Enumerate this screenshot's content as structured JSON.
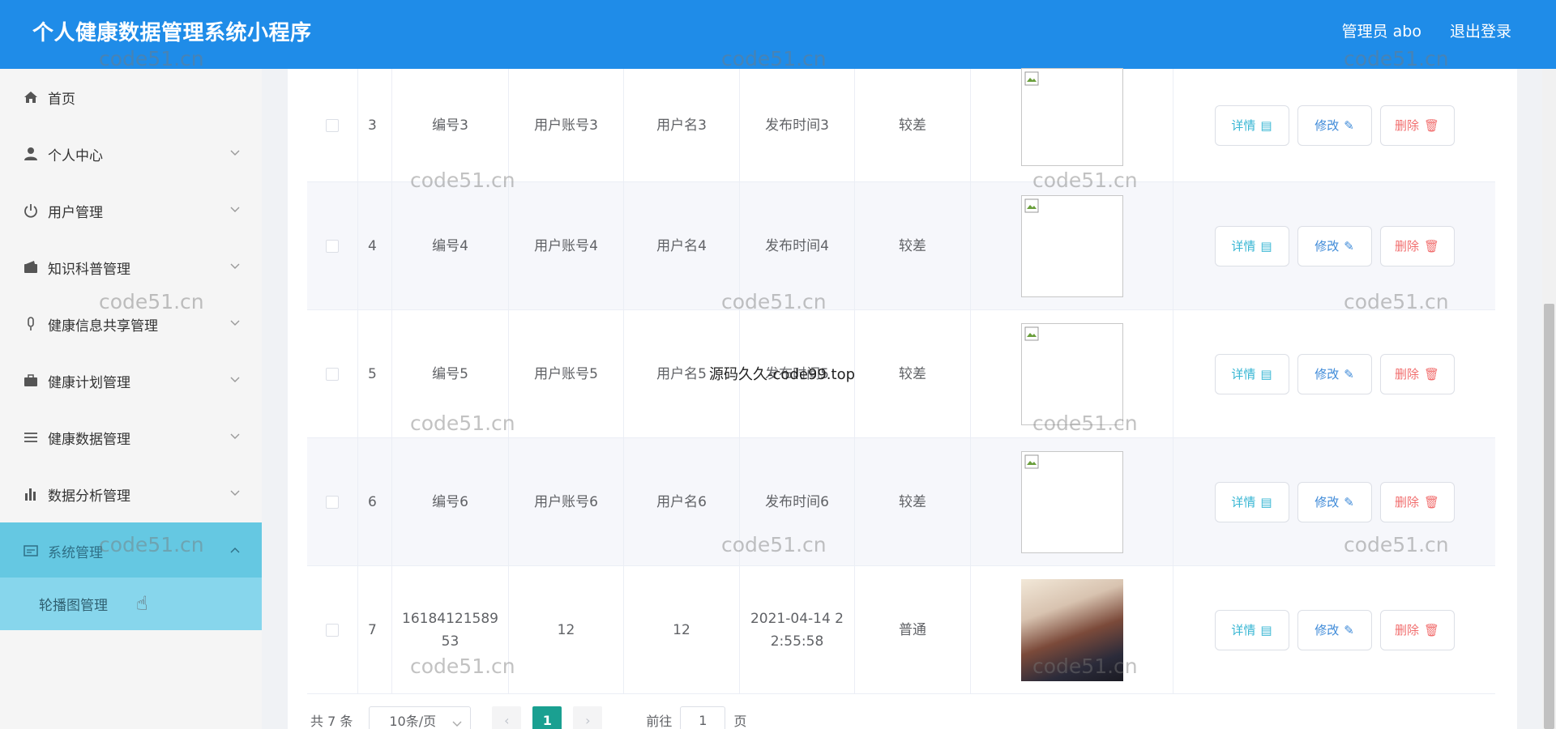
{
  "header": {
    "title": "个人健康数据管理系统小程序",
    "user": "管理员 abo",
    "logout": "退出登录"
  },
  "sidebar": {
    "items": [
      {
        "label": "首页",
        "icon": "home-icon"
      },
      {
        "label": "个人中心",
        "icon": "person-icon"
      },
      {
        "label": "用户管理",
        "icon": "power-icon"
      },
      {
        "label": "知识科普管理",
        "icon": "wallet-icon"
      },
      {
        "label": "健康信息共享管理",
        "icon": "mic-icon"
      },
      {
        "label": "健康计划管理",
        "icon": "briefcase-icon"
      },
      {
        "label": "健康数据管理",
        "icon": "list-icon"
      },
      {
        "label": "数据分析管理",
        "icon": "bar-chart-icon"
      },
      {
        "label": "系统管理",
        "icon": "window-icon"
      }
    ],
    "sub_item": "轮播图管理"
  },
  "table": {
    "rows": [
      {
        "index": "3",
        "code": "编号3",
        "account": "用户账号3",
        "name": "用户名3",
        "time": "发布时间3",
        "rating": "较差"
      },
      {
        "index": "4",
        "code": "编号4",
        "account": "用户账号4",
        "name": "用户名4",
        "time": "发布时间4",
        "rating": "较差"
      },
      {
        "index": "5",
        "code": "编号5",
        "account": "用户账号5",
        "name": "用户名5",
        "time": "发布时间5",
        "rating": "较差"
      },
      {
        "index": "6",
        "code": "编号6",
        "account": "用户账号6",
        "name": "用户名6",
        "time": "发布时间6",
        "rating": "较差"
      },
      {
        "index": "7",
        "code": "16184121589 53",
        "account": "12",
        "name": "12",
        "time": "2021-04-14 2 2:55:58",
        "rating": "普通"
      }
    ],
    "actions": {
      "detail": "详情",
      "edit": "修改",
      "delete": "删除"
    }
  },
  "pagination": {
    "total": "共 7 条",
    "page_size": "10条/页",
    "current": "1",
    "goto_label": "前往",
    "goto_value": "1",
    "page_suffix": "页"
  },
  "watermark": "code51.cn",
  "overlay": "源码久久-code99.top",
  "colors": {
    "header": "#1f8ce8",
    "active_menu": "#65c8e2",
    "sub_menu": "#87d6ec",
    "current_page": "#1aa091"
  }
}
